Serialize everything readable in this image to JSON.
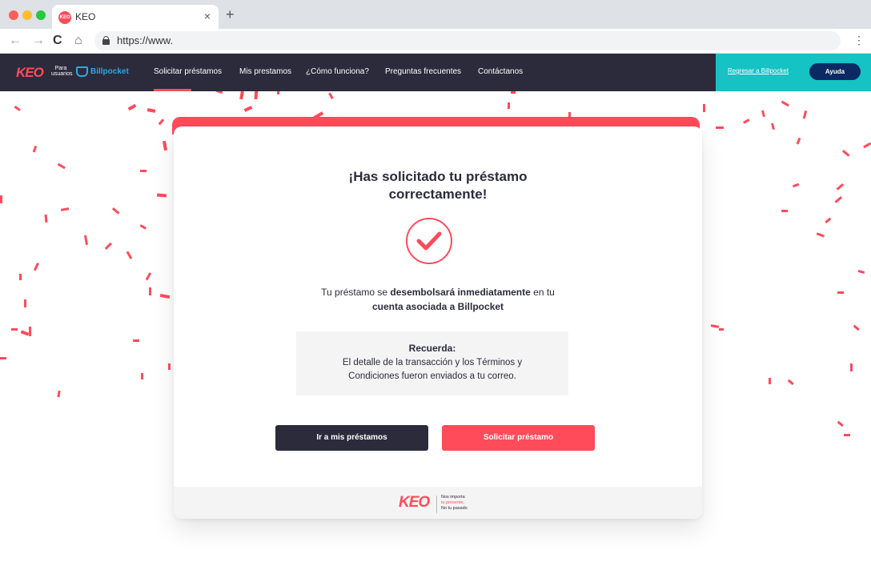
{
  "browser": {
    "tab_title": "KEO",
    "favicon_text": "KEO",
    "tab_close": "×",
    "new_tab": "+",
    "url": "https://www.",
    "back": "←",
    "forward": "→",
    "reload": "C",
    "home": "⌂",
    "menu": "⋮"
  },
  "navbar": {
    "brand_keo": "KEO",
    "brand_para": "Para usuarios",
    "brand_partner": "Billpocket",
    "menu": [
      "Solicitar préstamos",
      "Mis prestamos",
      "¿Cómo funciona?",
      "Preguntas frecuentes",
      "Contáctanos"
    ],
    "regresar": "Regresar a Billpocket",
    "ayuda": "Ayuda"
  },
  "card": {
    "title_line1": "¡Has solicitado tu préstamo",
    "title_line2": "correctamente!",
    "msg_part1": "Tu préstamo se ",
    "msg_bold1": "desembolsará inmediatamente",
    "msg_part2": " en tu",
    "msg_bold2": "cuenta asociada a Billpocket",
    "reminder_title": "Recuerda:",
    "reminder_line1": "El detalle de la transacción y los Términos y",
    "reminder_line2": "Condiciones fueron enviados a tu correo.",
    "btn_secondary": "Ir a mis préstamos",
    "btn_primary": "Solicitar préstamo",
    "footer_logo": "KEO",
    "footer_tag1": "Nos importa",
    "footer_tag2": "tu presente,",
    "footer_tag3": "No tu pasado"
  },
  "colors": {
    "accent": "#ff4b5a",
    "dark": "#2b2b3c",
    "teal": "#15c2c4",
    "navy": "#0b2a63",
    "partner_blue": "#29a9e1"
  },
  "icons": [
    "lock-icon",
    "success-check-icon",
    "billpocket-icon",
    "confetti-decoration"
  ]
}
